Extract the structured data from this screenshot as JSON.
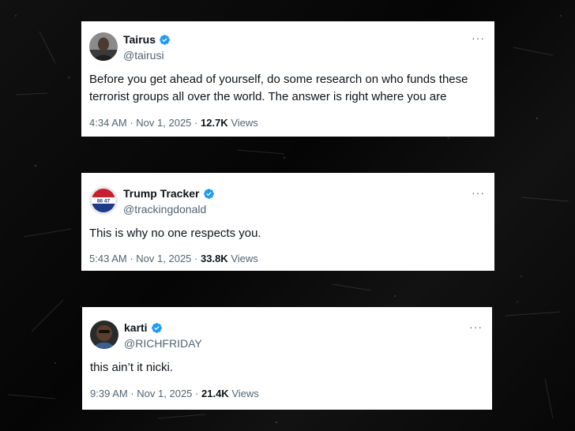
{
  "tweets": [
    {
      "display_name": "Tairus",
      "handle": "@tairusi",
      "verified": true,
      "text": "Before you get ahead of yourself, do some research on who funds these terrorist groups all over the world. The answer is right where you are",
      "time": "4:34 AM",
      "date": "Nov 1, 2025",
      "separator": "·",
      "views_count": "12.7K",
      "views_label": "Views",
      "more_label": "···"
    },
    {
      "display_name": "Trump Tracker",
      "handle": "@trackingdonald",
      "verified": true,
      "avatar_text": "86 47",
      "text": "This is why no one respects you.",
      "time": "5:43 AM",
      "date": "Nov 1, 2025",
      "separator": "·",
      "views_count": "33.8K",
      "views_label": "Views",
      "more_label": "···"
    },
    {
      "display_name": "karti",
      "handle": "@RICHFRIDAY",
      "verified": true,
      "text": "this ain’t it nicki.",
      "time": "9:39 AM",
      "date": "Nov 1, 2025",
      "separator": "·",
      "views_count": "21.4K",
      "views_label": "Views",
      "more_label": "···"
    }
  ],
  "colors": {
    "verified_blue": "#1d9bf0",
    "text_primary": "#0f1419",
    "text_secondary": "#536471",
    "card_bg": "#ffffff",
    "page_bg": "#0a0a0a"
  },
  "icons": {
    "verified": "verified-badge-icon",
    "more": "more-options-icon"
  }
}
